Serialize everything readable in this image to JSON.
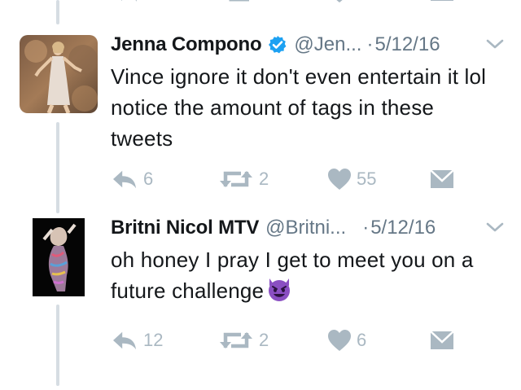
{
  "tweets": [
    {
      "name": "Jenna Compono",
      "verified": true,
      "handle": "@Jen...",
      "separator": "·",
      "date": "5/12/16",
      "text": "Vince ignore it don't even entertain it lol notice the amount of tags in these tweets",
      "replies": "6",
      "retweets": "2",
      "likes": "55"
    },
    {
      "name": "Britni Nicol MTV",
      "verified": false,
      "handle": "@Britni...",
      "separator": "·",
      "date": "5/12/16",
      "text": "oh honey I pray I get to meet you on a future challenge",
      "emoji": "smiling-imp-emoji",
      "replies": "12",
      "retweets": "2",
      "likes": "6"
    }
  ],
  "colors": {
    "text": "#14171a",
    "secondary": "#657786",
    "icon": "#aab8c2",
    "verified": "#1da1f2",
    "thread_line": "#d6dde3",
    "emoji": "#8a4fc2"
  },
  "icons": [
    "reply-icon",
    "retweet-icon",
    "like-icon",
    "direct-message-icon",
    "chevron-down-icon",
    "verified-badge-icon"
  ]
}
